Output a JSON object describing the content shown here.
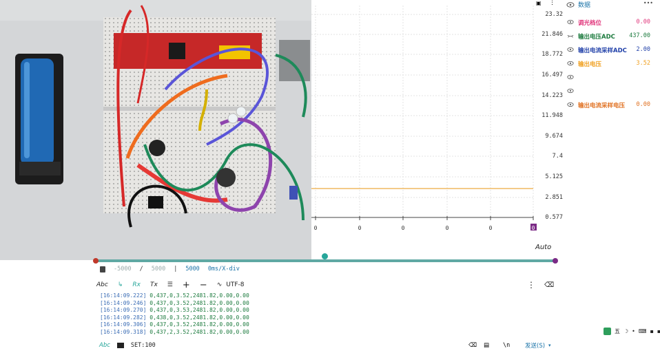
{
  "plot": {
    "y_ticks": [
      "23.32",
      "21.846",
      "18.772",
      "16.497",
      "14.223",
      "11.948",
      "9.674",
      "7.4",
      "5.125",
      "2.851",
      "0.577"
    ],
    "x_ticks": [
      "0",
      "0",
      "0",
      "0",
      "0",
      "0"
    ],
    "auto_label": "Auto",
    "trace_color": "#f0b860"
  },
  "xdiv": {
    "start": "-5000",
    "sep": "/",
    "end": "5000",
    "bar": "|",
    "count": "5000",
    "unit": "0ms/X-div"
  },
  "toolbar": {
    "abc": "Abc",
    "rx": "Rx",
    "tx": "Tx",
    "encoding": "UTF-8"
  },
  "log": [
    {
      "ts": "[16:14:09.222]",
      "msg": "0,437,0,3.52,2481.82,0.00,0.00"
    },
    {
      "ts": "[16:14:09.246]",
      "msg": "0,437,0,3.52,2481.82,0.00,0.00"
    },
    {
      "ts": "[16:14:09.270]",
      "msg": "0,437,0,3.53,2481.82,0.00,0.00"
    },
    {
      "ts": "[16:14:09.282]",
      "msg": "0,438,0,3.52,2481.82,0.00,0.00"
    },
    {
      "ts": "[16:14:09.306]",
      "msg": "0,437,0,3.52,2481.82,0.00,0.00"
    },
    {
      "ts": "[16:14:09.318]",
      "msg": "0,437,2,3.52,2481.82,0.00,0.00"
    }
  ],
  "bottom": {
    "abc": "Abc",
    "set": "SET:100",
    "newline": "\\n",
    "send": "发送(S)"
  },
  "panel": {
    "title": "数据",
    "more": "•••",
    "channels": [
      {
        "name": "调光档位",
        "value": "0.00",
        "color": "#e0347a"
      },
      {
        "name": "输出电压ADC",
        "value": "437.00",
        "color": "#1b7a3d"
      },
      {
        "name": "输出电流采样ADC",
        "value": "2.00",
        "color": "#1f3fa8"
      },
      {
        "name": "输出电压",
        "value": "3.52",
        "color": "#f0a020"
      },
      {
        "name": "",
        "value": "",
        "color": "#777777"
      },
      {
        "name": "",
        "value": "",
        "color": "#777777"
      },
      {
        "name": "输出电流采样电压",
        "value": "0.00",
        "color": "#e07020"
      }
    ]
  },
  "taskbar": {
    "ime": "五"
  }
}
